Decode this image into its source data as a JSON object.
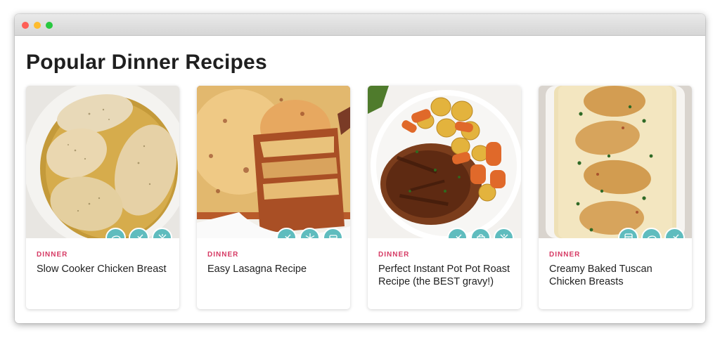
{
  "window": {
    "controls": [
      "close",
      "minimize",
      "zoom"
    ]
  },
  "page": {
    "title": "Popular Dinner Recipes"
  },
  "cards": [
    {
      "category": "DINNER",
      "title": "Slow Cooker Chicken Breast",
      "image": "slow-cooker-chicken-breast-photo",
      "icons": [
        "chicken-icon",
        "low-carb-icon",
        "no-cook-icon"
      ]
    },
    {
      "category": "DINNER",
      "title": "Easy Lasagna Recipe",
      "image": "easy-lasagna-photo",
      "icons": [
        "low-carb-icon",
        "freezer-friendly-icon",
        "casserole-icon"
      ]
    },
    {
      "category": "DINNER",
      "title": "Perfect Instant Pot Pot Roast Recipe (the BEST gravy!)",
      "image": "pot-roast-photo",
      "icons": [
        "low-carb-icon",
        "instant-pot-icon",
        "no-cook-icon"
      ]
    },
    {
      "category": "DINNER",
      "title": "Creamy Baked Tuscan Chicken Breasts",
      "image": "tuscan-chicken-photo",
      "icons": [
        "oven-icon",
        "chicken-icon",
        "low-carb-icon"
      ]
    }
  ],
  "colors": {
    "accent_category": "#d63a64",
    "icon_badge": "#5fbcbe"
  }
}
